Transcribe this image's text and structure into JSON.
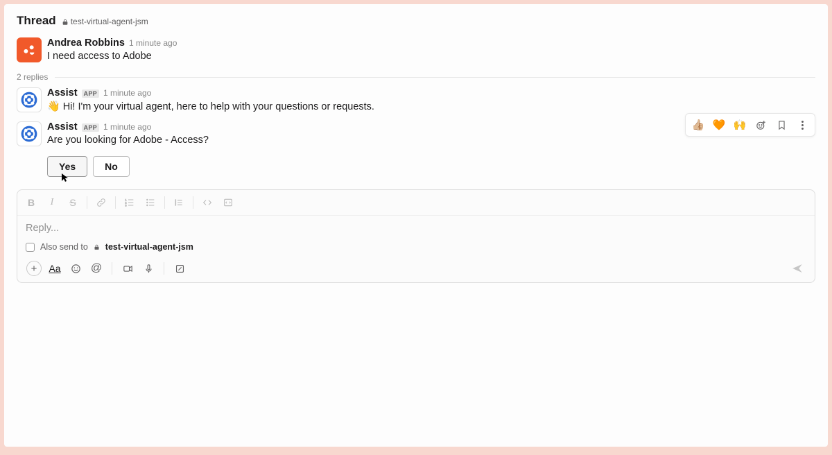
{
  "header": {
    "title": "Thread",
    "channel": "test-virtual-agent-jsm"
  },
  "original": {
    "author": "Andrea Robbins",
    "time": "1 minute ago",
    "text": "I need access to Adobe"
  },
  "replies_label": "2 replies",
  "messages": [
    {
      "author": "Assist",
      "app_badge": "APP",
      "time": "1 minute ago",
      "emoji": "👋",
      "text": "Hi! I'm your virtual agent, here to help with your questions or requests."
    },
    {
      "author": "Assist",
      "app_badge": "APP",
      "time": "1 minute ago",
      "text": "Are you looking for Adobe - Access?"
    }
  ],
  "buttons": {
    "yes": "Yes",
    "no": "No"
  },
  "hover_actions": {
    "thumbs": "👍🏼",
    "heart": "🧡",
    "pray": "🙌"
  },
  "composer": {
    "placeholder": "Reply...",
    "also_send_prefix": "Also send to",
    "also_send_channel": "test-virtual-agent-jsm"
  }
}
